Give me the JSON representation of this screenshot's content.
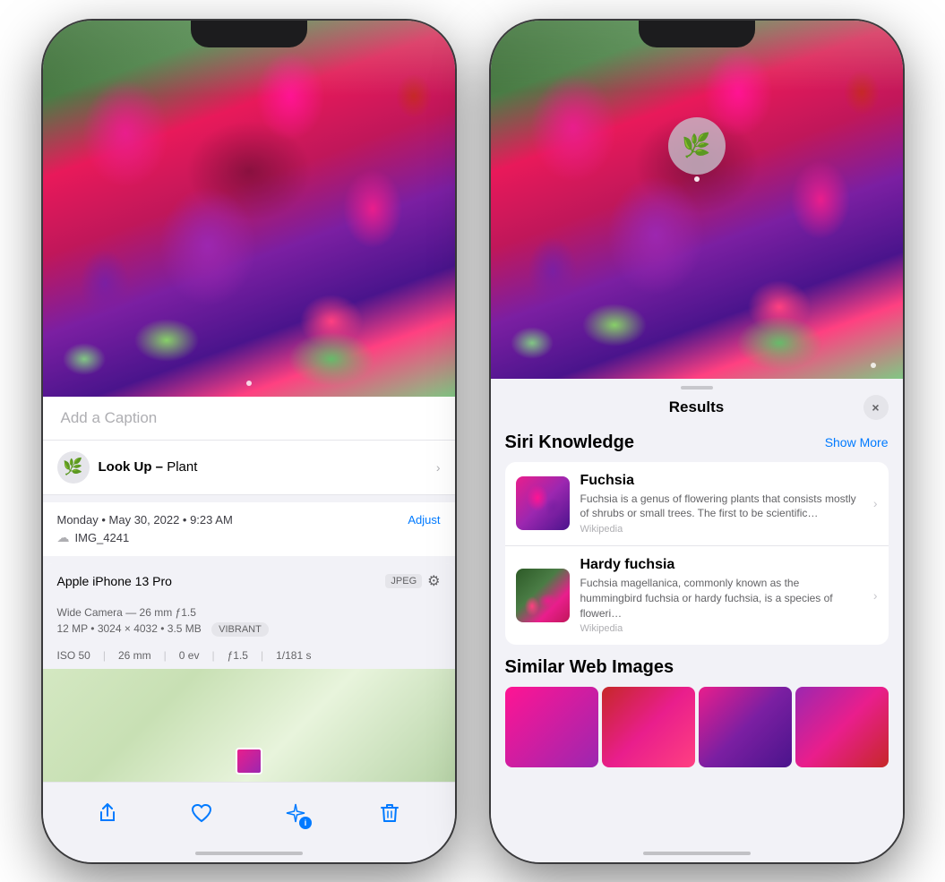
{
  "left_phone": {
    "caption_placeholder": "Add a Caption",
    "lookup_label": "Look Up –",
    "lookup_subject": "Plant",
    "meta_date": "Monday • May 30, 2022 • 9:23 AM",
    "meta_adjust": "Adjust",
    "meta_filename": "IMG_4241",
    "device_name": "Apple iPhone 13 Pro",
    "badge_jpeg": "JPEG",
    "camera_spec_line1": "Wide Camera — 26 mm ƒ1.5",
    "camera_spec_line2": "12 MP • 3024 × 4032 • 3.5 MB",
    "vibrant_label": "VIBRANT",
    "exif_iso": "ISO 50",
    "exif_mm": "26 mm",
    "exif_ev": "0 ev",
    "exif_aperture": "ƒ1.5",
    "exif_shutter": "1/181 s",
    "toolbar_share": "↑",
    "toolbar_heart": "♡",
    "toolbar_info": "✦",
    "toolbar_trash": "🗑"
  },
  "right_phone": {
    "results_title": "Results",
    "close_button": "×",
    "siri_knowledge_title": "Siri Knowledge",
    "show_more": "Show More",
    "item1_name": "Fuchsia",
    "item1_desc": "Fuchsia is a genus of flowering plants that consists mostly of shrubs or small trees. The first to be scientific…",
    "item1_source": "Wikipedia",
    "item2_name": "Hardy fuchsia",
    "item2_desc": "Fuchsia magellanica, commonly known as the hummingbird fuchsia or hardy fuchsia, is a species of floweri…",
    "item2_source": "Wikipedia",
    "similar_title": "Similar Web Images"
  }
}
